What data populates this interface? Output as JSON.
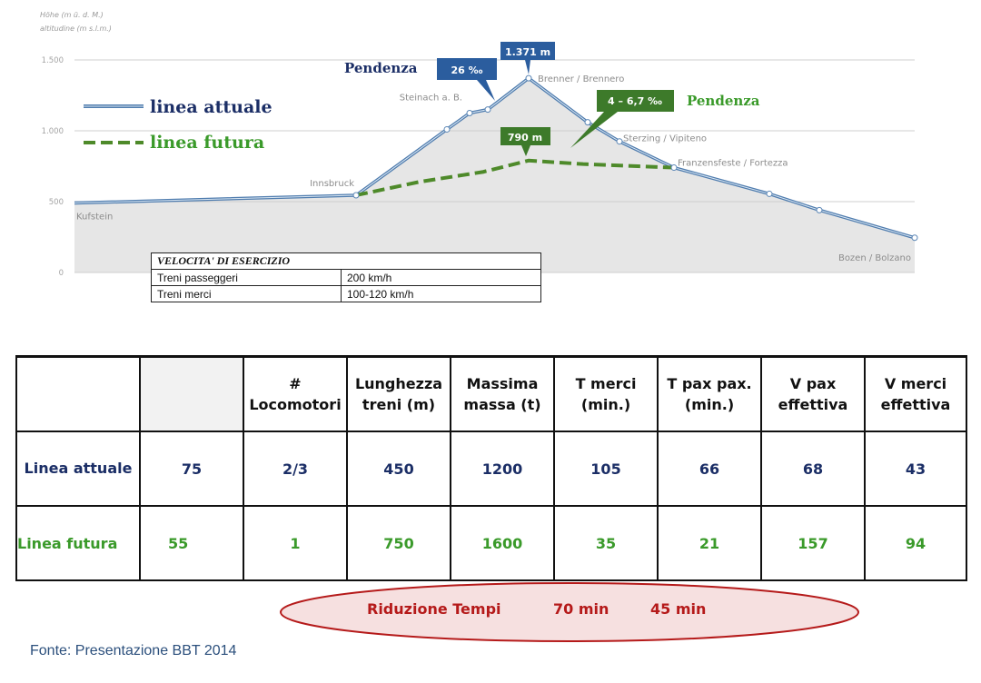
{
  "chart_data": {
    "type": "line",
    "axis_title_de": "Höhe (m ü. d. M.)",
    "axis_title_it": "altitudine (m s.l.m.)",
    "y_ticks": [
      "1.500",
      "1.000",
      "500",
      "0"
    ],
    "ylim": [
      0,
      1500
    ],
    "series": [
      {
        "name": "linea attuale",
        "color": "#5b86b5",
        "style": "solid",
        "points": [
          {
            "x": 0,
            "y": 490
          },
          {
            "x": 310,
            "y": 545
          },
          {
            "x": 410,
            "y": 1010
          },
          {
            "x": 435,
            "y": 1125
          },
          {
            "x": 455,
            "y": 1150
          },
          {
            "x": 500,
            "y": 1371
          },
          {
            "x": 565,
            "y": 1060
          },
          {
            "x": 600,
            "y": 925
          },
          {
            "x": 660,
            "y": 740
          },
          {
            "x": 765,
            "y": 555
          },
          {
            "x": 820,
            "y": 440
          },
          {
            "x": 925,
            "y": 245
          }
        ]
      },
      {
        "name": "linea futura",
        "color": "#4e8a2a",
        "style": "dashed",
        "points": [
          {
            "x": 310,
            "y": 545
          },
          {
            "x": 380,
            "y": 640
          },
          {
            "x": 450,
            "y": 710
          },
          {
            "x": 500,
            "y": 790
          },
          {
            "x": 560,
            "y": 765
          },
          {
            "x": 620,
            "y": 750
          },
          {
            "x": 660,
            "y": 740
          }
        ]
      }
    ],
    "stations": [
      {
        "name": "Kufstein",
        "x": 0,
        "y": 490
      },
      {
        "name": "Innsbruck",
        "x": 310,
        "y": 545
      },
      {
        "name": "Steinach a. B.",
        "x": 435,
        "y": 1125
      },
      {
        "name": "Brenner / Brennero",
        "x": 500,
        "y": 1371
      },
      {
        "name": "Sterzing / Vipiteno",
        "x": 600,
        "y": 925
      },
      {
        "name": "Franzensfeste / Fortezza",
        "x": 660,
        "y": 740
      },
      {
        "name": "Bozen / Bolzano",
        "x": 925,
        "y": 245
      }
    ],
    "annotations": {
      "summit_label": "1.371 m",
      "future_summit_label": "790 m",
      "pendenza_label": "Pendenza",
      "current_gradient": "26 ‰",
      "future_gradient": "4 – 6,7 ‰"
    },
    "legend": [
      "linea attuale",
      "linea futura"
    ]
  },
  "speed_table": {
    "title": "VELOCITA' DI ESERCIZIO",
    "rows": [
      {
        "label": "Treni passeggeri",
        "value": "200 km/h"
      },
      {
        "label": "Treni merci",
        "value": "100-120 km/h"
      }
    ]
  },
  "table": {
    "headers": [
      "",
      "# Locomotori",
      "Lunghezza treni (m)",
      "Massima massa (t)",
      "T merci (min.)",
      "T pax pax. (min.)",
      "V pax effettiva",
      "V merci effettiva"
    ],
    "rows": [
      {
        "label": "Linea attuale",
        "values": [
          "75",
          "2/3",
          "450",
          "1200",
          "105",
          "66",
          "68",
          "43"
        ]
      },
      {
        "label": "Linea futura",
        "values": [
          "55",
          "1",
          "750",
          "1600",
          "35",
          "21",
          "157",
          "94"
        ]
      }
    ]
  },
  "reduction": {
    "label": "Riduzione Tempi",
    "merci": "70 min",
    "pax": "45 min"
  },
  "source": "Fonte: Presentazione BBT 2014",
  "colors": {
    "current": "#1b2e66",
    "future": "#3a9a2a",
    "badge_blue": "#2b5d9e",
    "badge_green": "#3d7a2a",
    "ellipse_fill": "#f6e0e0",
    "ellipse_stroke": "#b51a1a"
  }
}
